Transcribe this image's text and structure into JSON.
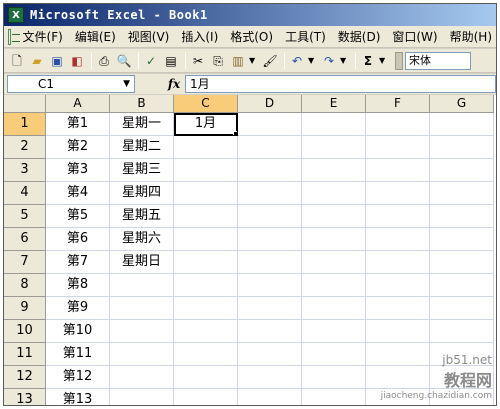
{
  "window": {
    "title": "Microsoft Excel - Book1",
    "app_icon_text": "X"
  },
  "menu": {
    "items": [
      "文件(F)",
      "编辑(E)",
      "视图(V)",
      "插入(I)",
      "格式(O)",
      "工具(T)",
      "数据(D)",
      "窗口(W)",
      "帮助(H)"
    ]
  },
  "toolbar": {
    "font_name": "宋体"
  },
  "formula": {
    "name_box": "C1",
    "fx_label": "fx",
    "content": "1月"
  },
  "sheet": {
    "columns": [
      "A",
      "B",
      "C",
      "D",
      "E",
      "F",
      "G"
    ],
    "active_column": "C",
    "active_row": 1,
    "rows": [
      {
        "num": "1",
        "cells": [
          "第1",
          "星期一",
          "1月",
          "",
          "",
          "",
          ""
        ]
      },
      {
        "num": "2",
        "cells": [
          "第2",
          "星期二",
          "",
          "",
          "",
          "",
          ""
        ]
      },
      {
        "num": "3",
        "cells": [
          "第3",
          "星期三",
          "",
          "",
          "",
          "",
          ""
        ]
      },
      {
        "num": "4",
        "cells": [
          "第4",
          "星期四",
          "",
          "",
          "",
          "",
          ""
        ]
      },
      {
        "num": "5",
        "cells": [
          "第5",
          "星期五",
          "",
          "",
          "",
          "",
          ""
        ]
      },
      {
        "num": "6",
        "cells": [
          "第6",
          "星期六",
          "",
          "",
          "",
          "",
          ""
        ]
      },
      {
        "num": "7",
        "cells": [
          "第7",
          "星期日",
          "",
          "",
          "",
          "",
          ""
        ]
      },
      {
        "num": "8",
        "cells": [
          "第8",
          "",
          "",
          "",
          "",
          "",
          ""
        ]
      },
      {
        "num": "9",
        "cells": [
          "第9",
          "",
          "",
          "",
          "",
          "",
          ""
        ]
      },
      {
        "num": "10",
        "cells": [
          "第10",
          "",
          "",
          "",
          "",
          "",
          ""
        ]
      },
      {
        "num": "11",
        "cells": [
          "第11",
          "",
          "",
          "",
          "",
          "",
          ""
        ]
      },
      {
        "num": "12",
        "cells": [
          "第12",
          "",
          "",
          "",
          "",
          "",
          ""
        ]
      },
      {
        "num": "13",
        "cells": [
          "第13",
          "",
          "",
          "",
          "",
          "",
          ""
        ]
      }
    ]
  },
  "watermark": {
    "line1": "jb51.net",
    "line2": "教程网",
    "line3": "jiaocheng.chazidian.com"
  }
}
